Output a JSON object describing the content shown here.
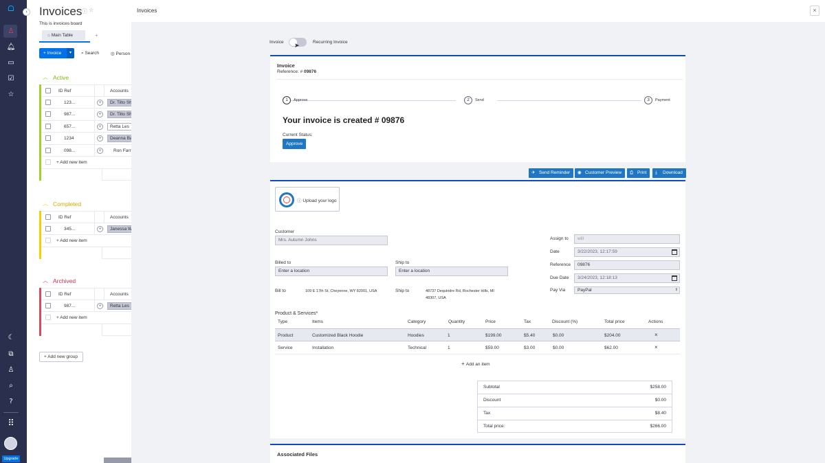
{
  "board": {
    "title": "Invoices",
    "description": "This is invoices board",
    "view_tab": "Main Table",
    "add_view": "+",
    "new_item_btn": "+ Invoice",
    "search_label": "Search",
    "person_label": "Person",
    "groups": [
      {
        "name": "Active",
        "color": "#9cd326",
        "col_id": "ID Ref",
        "col_acc": "Accounts",
        "rows": [
          {
            "id": "123...",
            "account": "Dr. Tilto Shi"
          },
          {
            "id": "987...",
            "account": "Dr. Tilto Shi"
          },
          {
            "id": "657...",
            "account": "Retta Les"
          },
          {
            "id": "1234",
            "account": "Deanna Ba"
          },
          {
            "id": "098...",
            "account": "Ron Farre"
          }
        ],
        "add_item": "+ Add new item"
      },
      {
        "name": "Completed",
        "color": "#ffcb00",
        "col_id": "ID Ref",
        "col_acc": "Accounts",
        "rows": [
          {
            "id": "345...",
            "account": "Janessa W"
          }
        ],
        "add_item": "+ Add new item"
      },
      {
        "name": "Archived",
        "color": "#e2445c",
        "col_id": "ID Ref",
        "col_acc": "Accounts",
        "rows": [
          {
            "id": "987...",
            "account": "Retta Les"
          }
        ],
        "add_item": "+ Add new item"
      }
    ],
    "add_group": "Add new group",
    "upgrade": "Upgrade"
  },
  "drawer": {
    "title": "Invoices",
    "close": "×",
    "toggle_left": "Invoice",
    "toggle_right": "Recurring Invoice",
    "invoice_heading": "Invoice",
    "reference_label": "Reference: #",
    "reference_value": "09876",
    "steps": [
      {
        "num": "1",
        "label": "Approve"
      },
      {
        "num": "2",
        "label": "Send"
      },
      {
        "num": "3",
        "label": "Payment"
      }
    ],
    "created_text": "Your invoice is created # 09876",
    "current_status_label": "Current Status:",
    "status_button": "Approve",
    "actions": [
      "Send Reminder",
      "Customer Preview",
      "Print",
      "Download"
    ],
    "upload_logo": "Upload your logo",
    "customer_label": "Customer",
    "customer_value": "Mrs. Autumn Johns",
    "billed_to_label": "Billed to",
    "billed_to_placeholder": "Enter a location",
    "ship_to_label": "Ship to",
    "ship_to_placeholder": "Enter a location",
    "bill_to_label": "Bill to",
    "bill_to_address": "109 E 17th St, Cheyenne, WY 82001, USA",
    "ship_to_label2": "Ship to",
    "ship_to_address_1": "48737 Dequindre Rd, Rochester Hills, MI",
    "ship_to_address_2": "48307, USA",
    "assign_to_label": "Assign to",
    "assign_to_value": "will",
    "date_label": "Date",
    "date_value": "3/22/2023, 12:17:59",
    "reference_field_label": "Reference",
    "reference_field_value": "09876",
    "due_date_label": "Due Date",
    "due_date_value": "3/24/2023, 12:18:13",
    "pay_via_label": "Pay Via",
    "pay_via_value": "PayPal",
    "products_title": "Product & Services*",
    "columns": [
      "Type",
      "Items",
      "Category",
      "Quantity",
      "Price",
      "Tax",
      "Discount (%)",
      "Total price",
      "Actions"
    ],
    "items": [
      {
        "type": "Product",
        "item": "Customized Black Hoodie",
        "category": "Hoodies",
        "qty": "1",
        "price": "$199.00",
        "tax": "$5.40",
        "discount": "$0.00",
        "total": "$204.00",
        "action": "×"
      },
      {
        "type": "Service",
        "item": "Installation",
        "category": "Technical",
        "qty": "1",
        "price": "$59.00",
        "tax": "$3.00",
        "discount": "$0.00",
        "total": "$62.00",
        "action": "×"
      }
    ],
    "add_item": "Add an item",
    "summary": [
      {
        "label": "Subtotal",
        "value": "$258.00"
      },
      {
        "label": "Discount",
        "value": "$0.00"
      },
      {
        "label": "Tax",
        "value": "$8.40"
      },
      {
        "label": "Total price:",
        "value": "$266.00"
      }
    ],
    "associated_files": "Associated Files"
  },
  "colors": {
    "nav_bg": "#292f4c",
    "accent": "#0073ea",
    "header_line": "#0f4cb7",
    "action_btn": "#1f76c2"
  }
}
